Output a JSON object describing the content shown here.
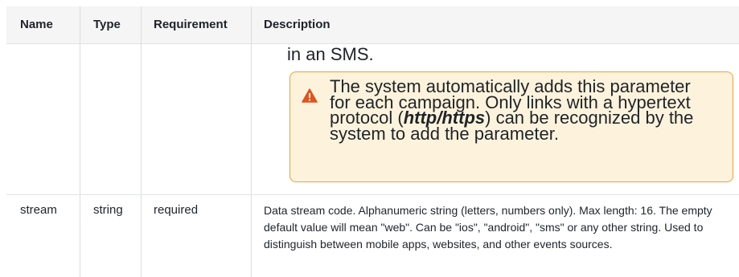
{
  "table": {
    "headers": {
      "name": "Name",
      "type": "Type",
      "requirement": "Requirement",
      "description": "Description"
    },
    "row1": {
      "description_tail": "in an SMS.",
      "callout": {
        "icon": "warning-triangle-icon",
        "text_before": "The system automatically adds this parameter for each campaign. Only links with a hypertext protocol (",
        "text_bold": "http/https",
        "text_after": ") can be recognized by the system to add the parameter."
      }
    },
    "row2": {
      "name": "stream",
      "type": "string",
      "requirement": "required",
      "description": "Data stream code. Alphanumeric string (letters, numbers only). Max length: 16. The empty default value will mean \"web\". Can be \"ios\", \"android\", \"sms\" or any other string. Used to distinguish between mobile apps, websites, and other events sources."
    }
  },
  "colors": {
    "header_bg": "#f5f5f6",
    "callout_bg": "#fdf3dd",
    "callout_border": "#e9a23b",
    "warning_icon": "#e0531f"
  }
}
